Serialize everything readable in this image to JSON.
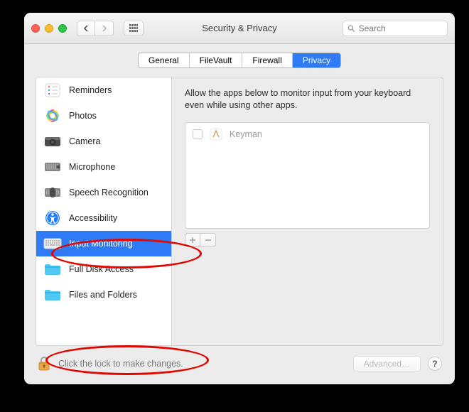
{
  "window": {
    "title": "Security & Privacy"
  },
  "search": {
    "placeholder": "Search"
  },
  "tabs": [
    {
      "label": "General",
      "active": false
    },
    {
      "label": "FileVault",
      "active": false
    },
    {
      "label": "Firewall",
      "active": false
    },
    {
      "label": "Privacy",
      "active": true
    }
  ],
  "sidebar": {
    "items": [
      {
        "label": "Reminders",
        "icon": "reminders",
        "selected": false
      },
      {
        "label": "Photos",
        "icon": "photos",
        "selected": false
      },
      {
        "label": "Camera",
        "icon": "camera",
        "selected": false
      },
      {
        "label": "Microphone",
        "icon": "microphone",
        "selected": false
      },
      {
        "label": "Speech Recognition",
        "icon": "speech",
        "selected": false
      },
      {
        "label": "Accessibility",
        "icon": "accessibility",
        "selected": false
      },
      {
        "label": "Input Monitoring",
        "icon": "keyboard",
        "selected": true
      },
      {
        "label": "Full Disk Access",
        "icon": "folder",
        "selected": false
      },
      {
        "label": "Files and Folders",
        "icon": "folder2",
        "selected": false
      }
    ]
  },
  "detail": {
    "description": "Allow the apps below to monitor input from your keyboard even while using other apps.",
    "apps": [
      {
        "name": "Keyman",
        "checked": false
      }
    ]
  },
  "footer": {
    "lock_text": "Click the lock to make changes.",
    "advanced_label": "Advanced…"
  }
}
